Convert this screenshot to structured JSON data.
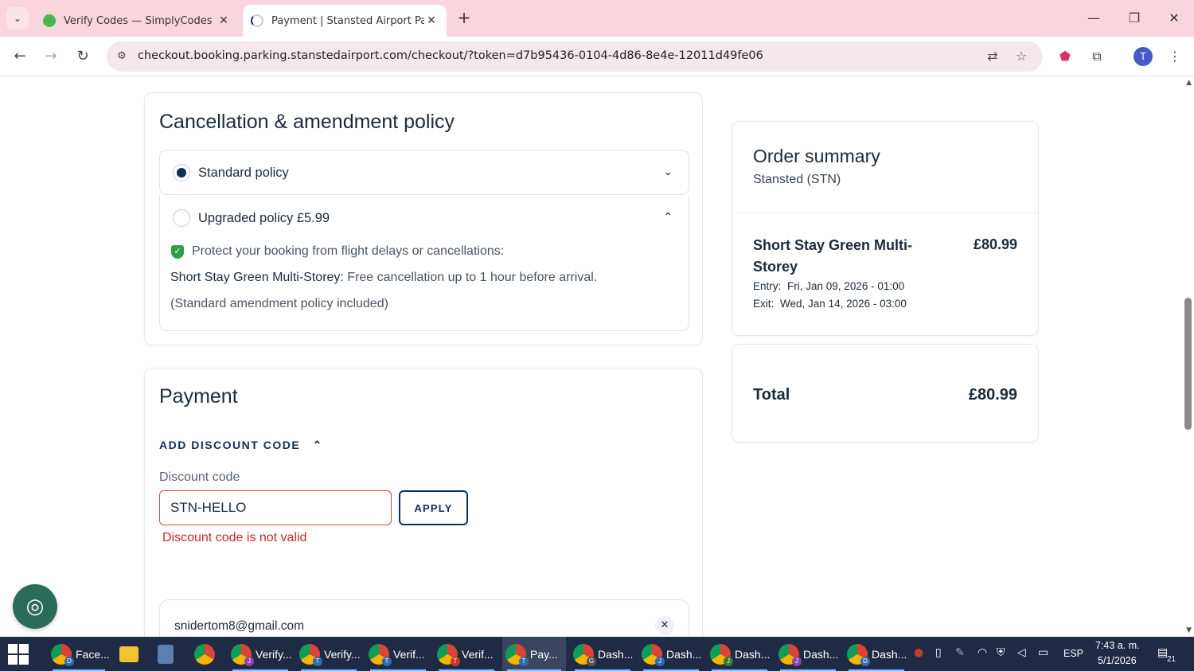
{
  "browser": {
    "tabs": [
      {
        "title": "Verify Codes — SimplyCodes",
        "active": false
      },
      {
        "title": "Payment | Stansted Airport Park",
        "active": true
      }
    ],
    "url": "checkout.booking.parking.stanstedairport.com/checkout/?token=d7b95436-0104-4d86-8e4e-12011d49fe06",
    "profile_initial": "T",
    "colors": {
      "tab_bar": "#f9d6de",
      "omnibox": "#f3e8ec"
    }
  },
  "cancellation": {
    "title": "Cancellation & amendment policy",
    "standard_label": "Standard policy",
    "upgraded_label": "Upgraded policy £5.99",
    "protect_text": "Protect your booking from flight delays or cancellations:",
    "detail_bold": "Short Stay Green Multi-Storey:",
    "detail_rest": " Free cancellation up to 1 hour before arrival.",
    "amendment_text": "(Standard amendment policy included)"
  },
  "payment": {
    "title": "Payment",
    "discount_link": "ADD DISCOUNT CODE",
    "discount_label": "Discount code",
    "discount_value": "STN-HELLO",
    "apply_label": "APPLY",
    "error": "Discount code is not valid",
    "email": "snidertom8@gmail.com"
  },
  "summary": {
    "title": "Order summary",
    "subtitle": "Stansted (STN)",
    "item_name": "Short Stay Green Multi-Storey",
    "item_price": "£80.99",
    "entry_label": "Entry:",
    "entry_value": "Fri, Jan 09, 2026 - 01:00",
    "exit_label": "Exit:",
    "exit_value": "Wed, Jan 14, 2026 - 03:00",
    "total_label": "Total",
    "total_value": "£80.99"
  },
  "taskbar": {
    "apps": [
      {
        "label": "Face...",
        "badge": "D",
        "badge_color": "#2b6cb0"
      },
      {
        "label": "",
        "icon": "file-explorer"
      },
      {
        "label": "",
        "icon": "calculator"
      },
      {
        "label": "",
        "icon": "chrome"
      },
      {
        "label": "Verify...",
        "badge": "J",
        "badge_color": "#8e44ad"
      },
      {
        "label": "Verify...",
        "badge": "T",
        "badge_color": "#2b6cb0"
      },
      {
        "label": "Verif...",
        "badge": "T",
        "badge_color": "#2b6cb0"
      },
      {
        "label": "Verif...",
        "badge": "T",
        "badge_color": "#c0392b"
      },
      {
        "label": "Pay...",
        "badge": "T",
        "badge_color": "#2b6cb0"
      },
      {
        "label": "Dash...",
        "badge": "G",
        "badge_color": "#555"
      },
      {
        "label": "Dash...",
        "badge": "J",
        "badge_color": "#2b6cb0"
      },
      {
        "label": "Dash...",
        "badge": "J",
        "badge_color": "#2e7d32"
      },
      {
        "label": "Dash...",
        "badge": "J",
        "badge_color": "#8e44ad"
      },
      {
        "label": "Dash...",
        "badge": "D",
        "badge_color": "#2b6cb0"
      }
    ],
    "language": "ESP",
    "time": "7:43 a. m.",
    "date": "5/1/2026",
    "notifications": "21"
  }
}
